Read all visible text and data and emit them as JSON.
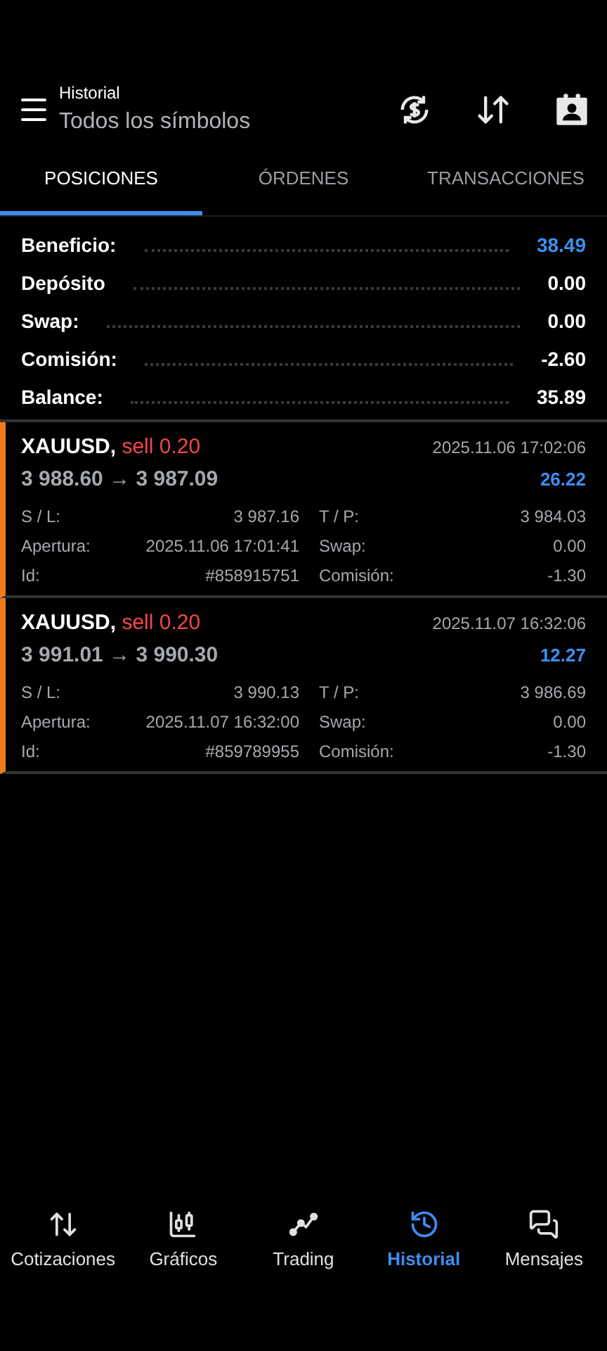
{
  "header": {
    "title": "Historial",
    "subtitle": "Todos los símbolos"
  },
  "tabs": [
    {
      "label": "POSICIONES",
      "selected": true
    },
    {
      "label": "ÓRDENES",
      "selected": false
    },
    {
      "label": "TRANSACCIONES",
      "selected": false
    }
  ],
  "summary": [
    {
      "label": "Beneficio:",
      "value": "38.49",
      "highlight": true
    },
    {
      "label": "Depósito",
      "value": "0.00",
      "highlight": false
    },
    {
      "label": "Swap:",
      "value": "0.00",
      "highlight": false
    },
    {
      "label": "Comisión:",
      "value": "-2.60",
      "highlight": false
    },
    {
      "label": "Balance:",
      "value": "35.89",
      "highlight": false
    }
  ],
  "positions": [
    {
      "symbol": "XAUUSD,",
      "kind": "sell",
      "side": "sell",
      "volume": "0.20",
      "time": "2025.11.06 17:02:06",
      "prices": "3 988.60 → 3 987.09",
      "profit": "26.22",
      "details": [
        [
          "S / L:",
          "3 987.16",
          "T / P:",
          "3 984.03"
        ],
        [
          "Apertura:",
          "2025.11.06 17:01:41",
          "Swap:",
          "0.00"
        ],
        [
          "Id:",
          "#858915751",
          "Comisión:",
          "-1.30"
        ]
      ]
    },
    {
      "symbol": "XAUUSD,",
      "kind": "sell",
      "side": "sell",
      "volume": "0.20",
      "time": "2025.11.07 16:32:06",
      "prices": "3 991.01 → 3 990.30",
      "profit": "12.27",
      "details": [
        [
          "S / L:",
          "3 990.13",
          "T / P:",
          "3 986.69"
        ],
        [
          "Apertura:",
          "2025.11.07 16:32:00",
          "Swap:",
          "0.00"
        ],
        [
          "Id:",
          "#859789955",
          "Comisión:",
          "-1.30"
        ]
      ]
    }
  ],
  "nav": [
    {
      "label": "Cotizaciones",
      "kind": "quotes",
      "selected": false
    },
    {
      "label": "Gráficos",
      "kind": "charts",
      "selected": false
    },
    {
      "label": "Trading",
      "kind": "trading",
      "selected": false
    },
    {
      "label": "Historial",
      "kind": "history",
      "selected": true
    },
    {
      "label": "Mensajes",
      "kind": "messages",
      "selected": false
    }
  ]
}
